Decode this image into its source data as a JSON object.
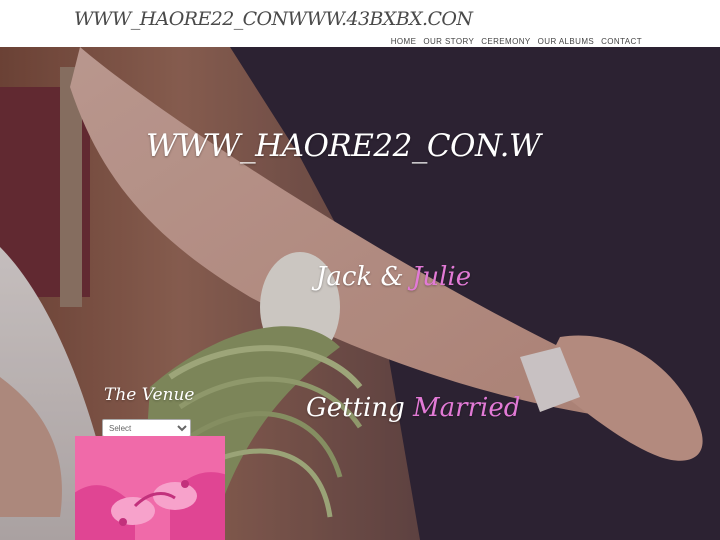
{
  "header": {
    "site_title": "WWW_HAORE22_CONWWW.43BXBX.CON",
    "nav": [
      "HOME",
      "OUR STORY",
      "CEREMONY",
      "OUR ALBUMS",
      "CONTACT"
    ]
  },
  "hero": {
    "title": "WWW_HAORE22_CON.W",
    "couple": {
      "name1": "Jack",
      "amp": " & ",
      "name2": "Julie"
    },
    "tagline": {
      "word1": "Getting",
      "word2": " Married"
    }
  },
  "venue": {
    "title": "The Venue",
    "select_value": "Select"
  },
  "colors": {
    "accent_pink": "#e27ad6",
    "header_bg": "#ffffff"
  }
}
